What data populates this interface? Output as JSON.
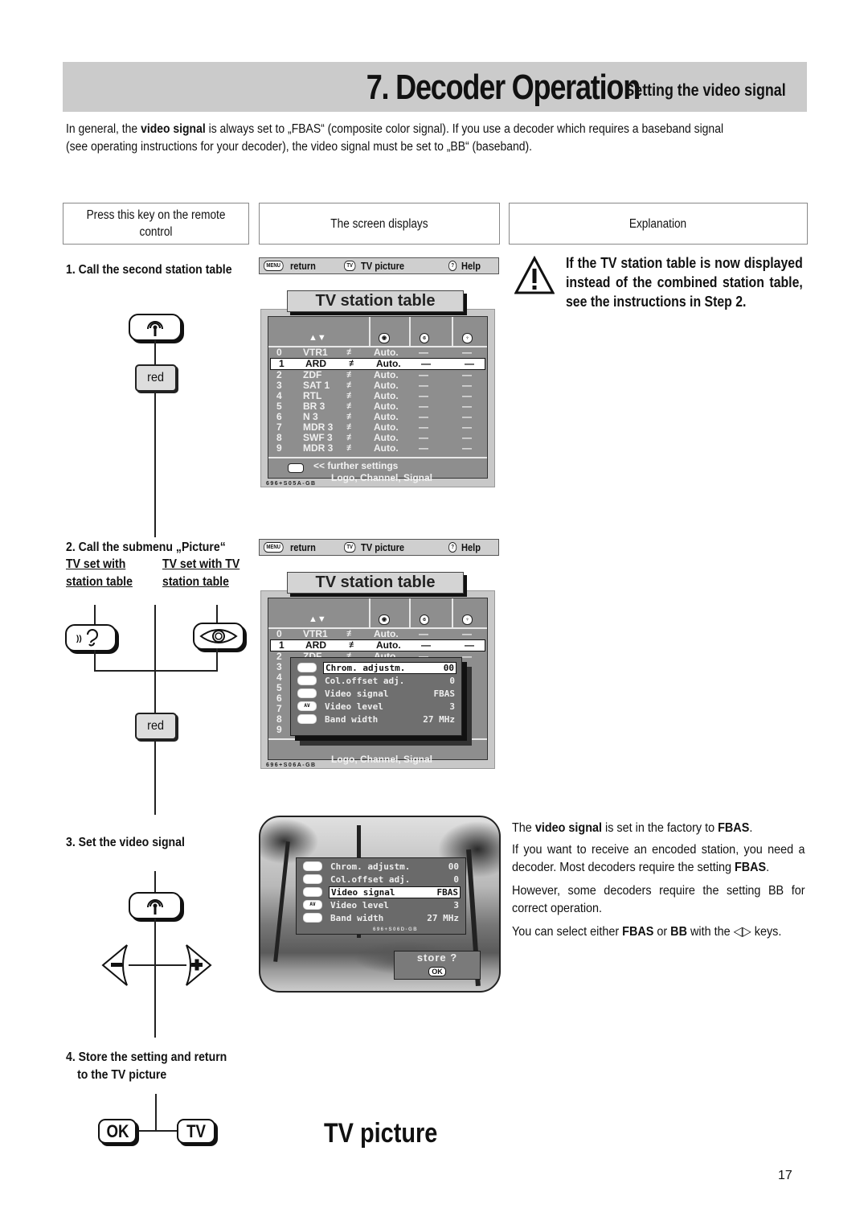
{
  "header": {
    "title": "7. Decoder Operation",
    "subtitle": "Setting the video signal",
    "background": "#cbcbcb"
  },
  "intro": {
    "p1_pre": "In general, the ",
    "p1_bold": "video signal",
    "p1_post": " is always set to „FBAS“ (composite color signal). If you use a decoder which requires a baseband signal",
    "p2": "(see operating instructions for your decoder), the video signal must be set to „BB“ (baseband)."
  },
  "columns": {
    "press": "Press this key on the remote control",
    "screen": "The screen displays",
    "explanation": "Explanation"
  },
  "steps": {
    "s1": "1. Call the second station table",
    "s2": "2. Call the submenu „Picture“",
    "s2_left": "TV set with station table",
    "s2_right": "TV set with TV station table",
    "s3": "3. Set the video signal",
    "s4_line1": "4. Store the setting and return",
    "s4_line2": "to the TV picture"
  },
  "keys": {
    "red": "red",
    "ok": "OK",
    "tv": "TV",
    "minus": "−",
    "plus": "+"
  },
  "osd": {
    "topbar": {
      "menu_pill": "MENU",
      "return": "return",
      "tv_pill": "TV",
      "tv_picture": "TV picture",
      "help_pill": "?",
      "help": "Help"
    },
    "station_table_title": "TV station table",
    "sort_arrows": "▲▼",
    "stations": [
      {
        "num": "0",
        "name": "VTR1",
        "mode": "Auto.",
        "c1": "—",
        "c2": "—"
      },
      {
        "num": "1",
        "name": "ARD",
        "mode": "Auto.",
        "c1": "—",
        "c2": "—",
        "selected": true
      },
      {
        "num": "2",
        "name": "ZDF",
        "mode": "Auto.",
        "c1": "—",
        "c2": "—"
      },
      {
        "num": "3",
        "name": "SAT 1",
        "mode": "Auto.",
        "c1": "—",
        "c2": "—"
      },
      {
        "num": "4",
        "name": "RTL",
        "mode": "Auto.",
        "c1": "—",
        "c2": "—"
      },
      {
        "num": "5",
        "name": "BR 3",
        "mode": "Auto.",
        "c1": "—",
        "c2": "—"
      },
      {
        "num": "6",
        "name": "N 3",
        "mode": "Auto.",
        "c1": "—",
        "c2": "—"
      },
      {
        "num": "7",
        "name": "MDR 3",
        "mode": "Auto.",
        "c1": "—",
        "c2": "—"
      },
      {
        "num": "8",
        "name": "SWF 3",
        "mode": "Auto.",
        "c1": "—",
        "c2": "—"
      },
      {
        "num": "9",
        "name": "MDR 3",
        "mode": "Auto.",
        "c1": "—",
        "c2": "—"
      }
    ],
    "further_settings": "<<  further settings",
    "logo_channel_signal": "Logo, Channel, Signal",
    "code1": "696+S05A-GB",
    "code2": "696+S06A-GB",
    "code3": "696+S06D-GB",
    "submenu": [
      {
        "icon": "eye",
        "label": "Chrom. adjustm.",
        "value": "00"
      },
      {
        "icon": "ear",
        "label": "Col.offset adj.",
        "value": "0"
      },
      {
        "icon": "antenna",
        "label": "Video signal",
        "value": "FBAS"
      },
      {
        "icon": "AV",
        "label": "Video level",
        "value": "3"
      },
      {
        "icon": "blank",
        "label": "Band width",
        "value": "27 MHz"
      }
    ],
    "store_prompt": "store ?",
    "store_ok": "OK"
  },
  "explanations": {
    "warning": "If the TV station table is now displayed instead of the combined station table, see the instructions in Step 2.",
    "e1_pre": "The ",
    "e1_b1": "video signal",
    "e1_mid": " is set in the factory to ",
    "e1_b2": "FBAS",
    "e1_post": ".",
    "e2_pre": "If you want to receive an encoded station, you need a decoder. Most decoders require the setting ",
    "e2_b": "FBAS",
    "e2_post": ".",
    "e3": "However, some decoders require the setting BB for correct operation.",
    "e4_pre": "You can select either ",
    "e4_b1": "FBAS",
    "e4_mid": " or ",
    "e4_b2": "BB",
    "e4_post": " with the ◁▷ keys."
  },
  "result": "TV picture",
  "page_number": "17"
}
